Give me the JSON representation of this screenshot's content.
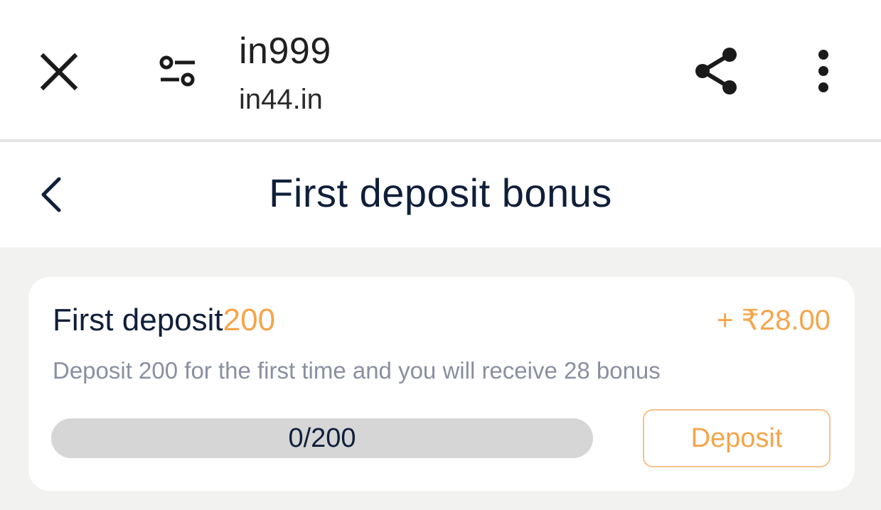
{
  "browser": {
    "site_title": "in999",
    "site_url": "in44.in",
    "icons": {
      "close": "close-icon",
      "tune": "site-settings-icon",
      "share": "share-icon",
      "more": "more-vertical-icon"
    }
  },
  "header": {
    "title": "First deposit bonus",
    "back_icon": "chevron-left-icon"
  },
  "bonus_card": {
    "title_prefix": "First deposit",
    "title_amount": "200",
    "reward": "+ ₹28.00",
    "description": "Deposit 200 for the first time and you will receive 28 bonus",
    "progress_text": "0/200",
    "progress_fraction": 0,
    "deposit_label": "Deposit"
  },
  "colors": {
    "accent": "#f5a54a",
    "title_text": "#0f1f3a",
    "muted_text": "#8a8fa0",
    "progress_track": "#d6d6d6",
    "page_background": "#f2f2f0"
  }
}
